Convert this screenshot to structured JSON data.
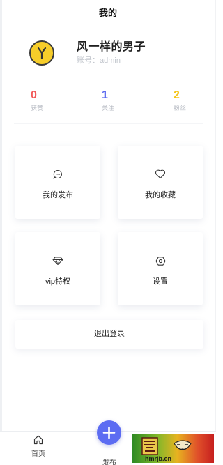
{
  "header": {
    "title": "我的"
  },
  "profile": {
    "name": "风一样的男子",
    "account": "账号：admin"
  },
  "stats": [
    {
      "value": "0",
      "label": "获赞",
      "color": "#f25a5a"
    },
    {
      "value": "1",
      "label": "关注",
      "color": "#5a69ef"
    },
    {
      "value": "2",
      "label": "粉丝",
      "color": "#f5c518"
    }
  ],
  "menu": [
    {
      "label": "我的发布",
      "icon": "comment-icon"
    },
    {
      "label": "我的收藏",
      "icon": "heart-icon"
    },
    {
      "label": "vip特权",
      "icon": "diamond-icon"
    },
    {
      "label": "设置",
      "icon": "settings-icon"
    }
  ],
  "logout": {
    "label": "退出登录"
  },
  "tabbar": {
    "home_label": "首页",
    "publish_label": "发布",
    "accent": "#5c6cf2"
  },
  "watermark": {
    "text": "hmrjb.cn"
  }
}
